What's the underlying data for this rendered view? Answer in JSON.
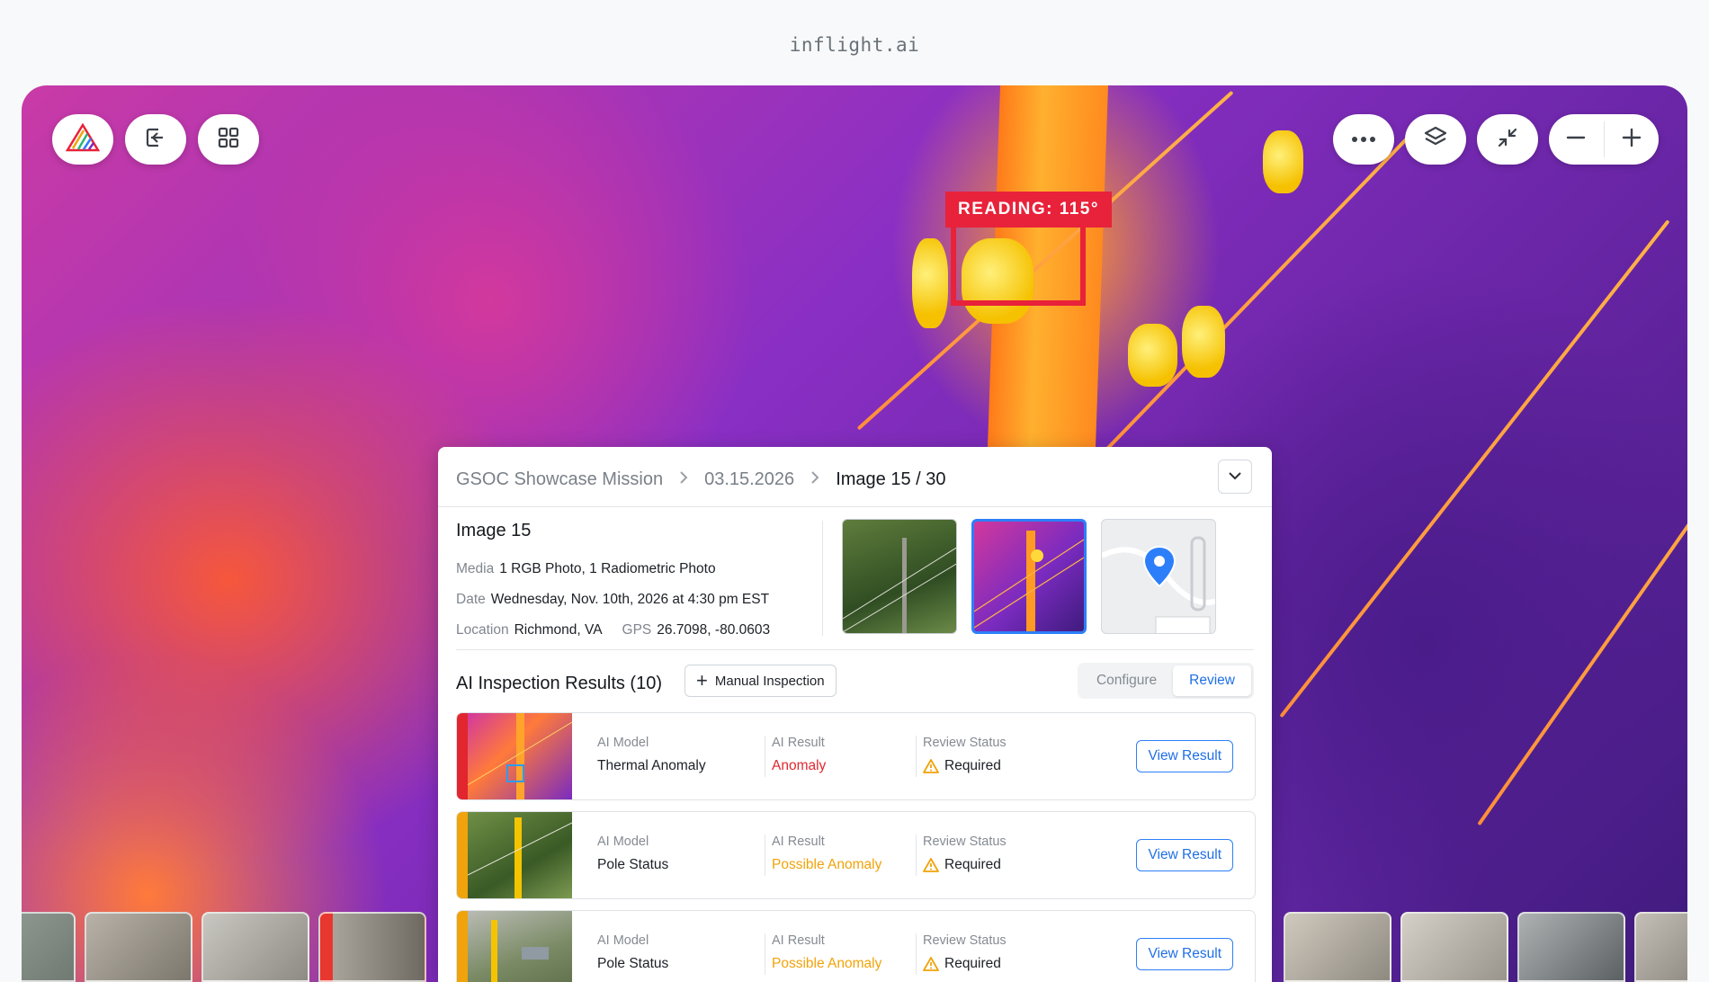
{
  "brand": "inflight.ai",
  "viewer": {
    "reading_label": "READING: 115°"
  },
  "toolbar_left": {
    "logo_icon": "inflight-logo-icon",
    "exit_icon": "exit-icon",
    "grid_icon": "grid-icon"
  },
  "toolbar_right": {
    "more_icon": "more-icon",
    "layers_icon": "layers-icon",
    "minimize_icon": "minimize-icon",
    "zoom_out_icon": "minus-icon",
    "zoom_in_icon": "plus-icon"
  },
  "panel": {
    "breadcrumb": [
      "GSOC Showcase Mission",
      "03.15.2026",
      "Image 15 / 30"
    ],
    "image_title": "Image 15",
    "media_label": "Media",
    "media_value": "1 RGB Photo, 1 Radiometric Photo",
    "date_label": "Date",
    "date_value": "Wednesday, Nov. 10th, 2026 at 4:30 pm EST",
    "location_label": "Location",
    "location_value": "Richmond, VA",
    "gps_label": "GPS",
    "gps_value": "26.7098, -80.0603",
    "results_title": "AI Inspection Results (10)",
    "manual_button": "Manual Inspection",
    "segment": {
      "configure": "Configure",
      "review": "Review",
      "active": "Review"
    },
    "results": [
      {
        "model_label": "AI Model",
        "model": "Thermal Anomaly",
        "result_label": "AI Result",
        "result": "Anomaly",
        "result_color": "#e1262f",
        "status_label": "Review Status",
        "status": "Required",
        "button": "View Result",
        "accent": "#e1262f"
      },
      {
        "model_label": "AI Model",
        "model": "Pole Status",
        "result_label": "AI Result",
        "result": "Possible Anomaly",
        "result_color": "#f0a30a",
        "status_label": "Review Status",
        "status": "Required",
        "button": "View Result",
        "accent": "#f0a30a"
      },
      {
        "model_label": "AI Model",
        "model": "Pole Status",
        "result_label": "AI Result",
        "result": "Possible Anomaly",
        "result_color": "#f0a30a",
        "status_label": "Review Status",
        "status": "Required",
        "button": "View Result",
        "accent": "#f0a30a"
      }
    ]
  },
  "colors": {
    "accent_blue": "#2d7ff9",
    "alert_red": "#e8223a",
    "warning_amber": "#f0a30a"
  }
}
